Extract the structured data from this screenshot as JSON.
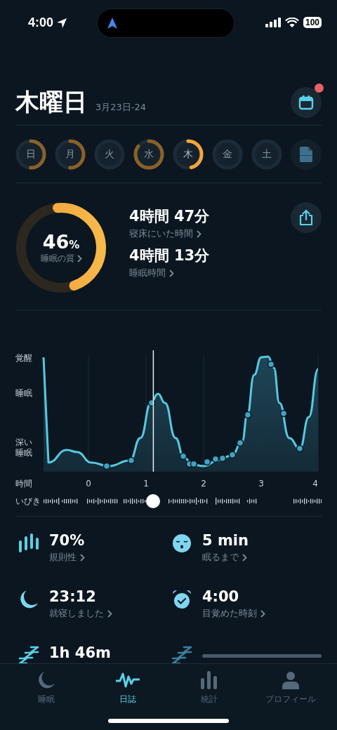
{
  "status_bar": {
    "time": "4:00",
    "battery": "100"
  },
  "header": {
    "title": "木曜日",
    "date_range": "3月23日-24",
    "calendar_badge": true
  },
  "days": [
    {
      "label": "日",
      "selected": false
    },
    {
      "label": "月",
      "selected": false
    },
    {
      "label": "火",
      "selected": false
    },
    {
      "label": "水",
      "selected": false
    },
    {
      "label": "木",
      "selected": true
    },
    {
      "label": "金",
      "selected": false
    },
    {
      "label": "土",
      "selected": false
    }
  ],
  "summary": {
    "quality": {
      "value": "46",
      "unit": "%",
      "label": "睡眠の質"
    },
    "stats": [
      {
        "value": "4時間 47分",
        "label": "寝床にいた時間"
      },
      {
        "value": "4時間 13分",
        "label": "睡眠時間"
      }
    ]
  },
  "hypnogram": {
    "y_labels": [
      "覚醒",
      "睡眠",
      "深い睡眠"
    ],
    "x_title": "時間",
    "x_labels": [
      "0",
      "1",
      "2",
      "3",
      "4"
    ],
    "snore_label": "いびき"
  },
  "metrics": [
    {
      "kind": "value",
      "value": "70%",
      "label": "規則性"
    },
    {
      "kind": "value",
      "value": "5 min",
      "label": "眠るまで"
    },
    {
      "kind": "value",
      "value": "23:12",
      "label": "就寝しました"
    },
    {
      "kind": "value",
      "value": "4:00",
      "label": "目覚めた時刻"
    },
    {
      "kind": "value",
      "value": "1h 46m"
    },
    {
      "kind": "loading"
    }
  ],
  "tabs": [
    {
      "label": "睡眠",
      "selected": false
    },
    {
      "label": "日誌",
      "selected": true
    },
    {
      "label": "統計",
      "selected": false
    },
    {
      "label": "プロフィール",
      "selected": false
    }
  ]
}
